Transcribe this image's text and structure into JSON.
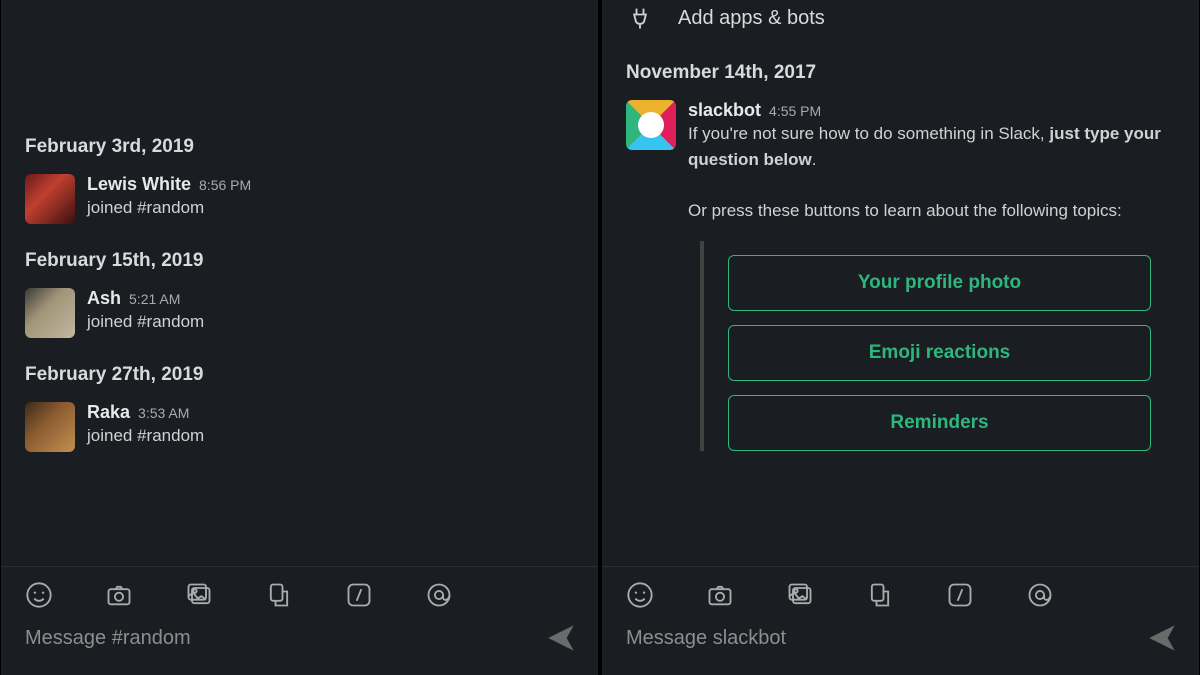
{
  "left": {
    "dates": [
      {
        "label": "February 3rd, 2019"
      },
      {
        "label": "February 15th, 2019"
      },
      {
        "label": "February 27th, 2019"
      }
    ],
    "messages": [
      {
        "user": "Lewis White",
        "time": "8:56 PM",
        "text": "joined #random"
      },
      {
        "user": "Ash",
        "time": "5:21 AM",
        "text": "joined #random"
      },
      {
        "user": "Raka",
        "time": "3:53 AM",
        "text": "joined #random"
      }
    ],
    "input_placeholder": "Message #random"
  },
  "right": {
    "add_apps_label": "Add apps & bots",
    "date_label": "November 14th, 2017",
    "bot_user": "slackbot",
    "bot_time": "4:55 PM",
    "bot_text_line1_a": "If you're not sure how to do something in Slack, ",
    "bot_text_line1_b": "just type your question below",
    "bot_text_line1_c": ".",
    "bot_text_line2": "Or press these buttons to learn about the following topics:",
    "topics": [
      {
        "label": "Your profile photo"
      },
      {
        "label": "Emoji reactions"
      },
      {
        "label": "Reminders"
      }
    ],
    "input_placeholder": "Message slackbot"
  }
}
